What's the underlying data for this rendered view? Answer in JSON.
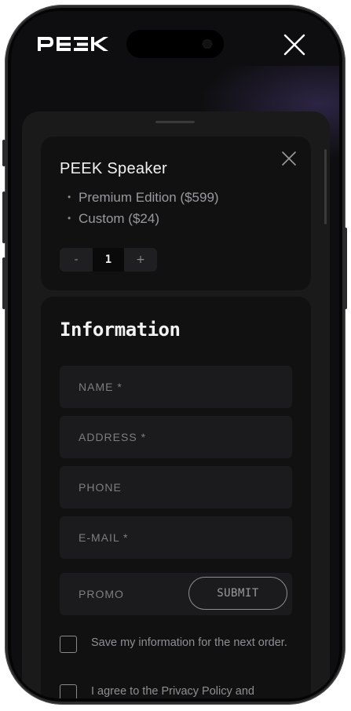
{
  "header": {
    "logo_text": "PEEK"
  },
  "cart_item": {
    "title": "PEEK Speaker",
    "options": [
      "Premium Edition ($599)",
      "Custom ($24)"
    ],
    "quantity": "1",
    "decrement_label": "-",
    "increment_label": "+"
  },
  "form": {
    "title": "Information",
    "name_placeholder": "NAME *",
    "address_placeholder": "ADDRESS *",
    "phone_placeholder": "PHONE",
    "email_placeholder": "E-MAIL *",
    "promo_placeholder": "PROMO",
    "submit_label": "SUBMIT",
    "save_info_label": "Save my information for the next order.",
    "privacy_label": "I agree to the Privacy Policy and"
  },
  "colors": {
    "background": "#0e0e10",
    "sheet": "#1a1a1b",
    "card": "#111112",
    "field": "#1b1b1d",
    "text_primary": "#f2f2f2",
    "text_muted": "#8f8f93"
  }
}
